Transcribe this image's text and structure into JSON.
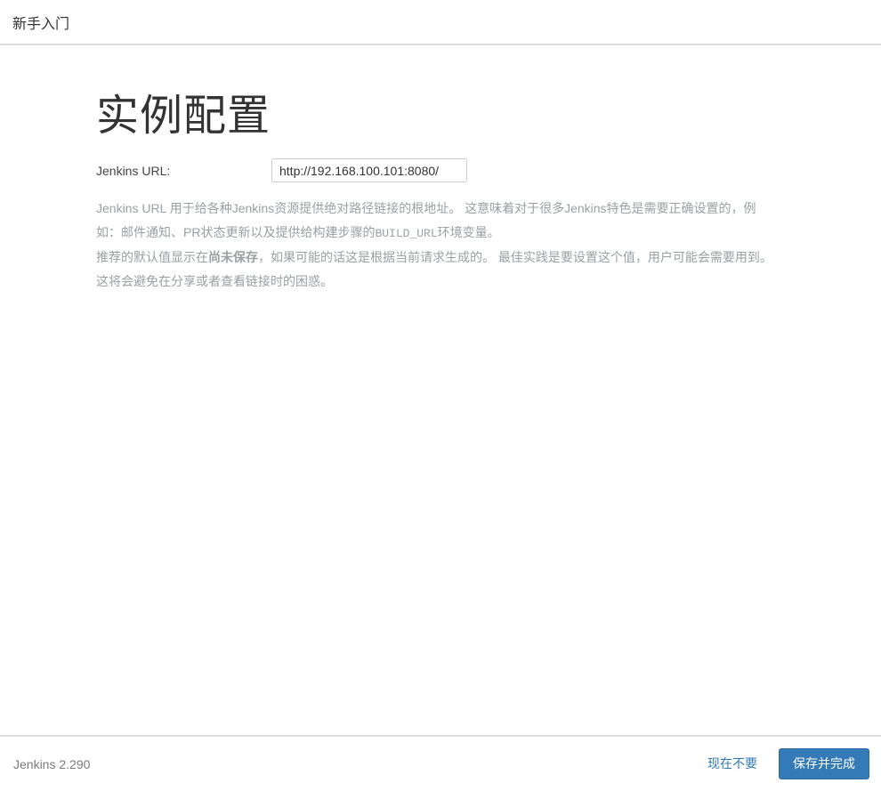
{
  "header": {
    "title": "新手入门"
  },
  "main": {
    "title": "实例配置",
    "form": {
      "label": "Jenkins URL:",
      "input_value": "http://192.168.100.101:8080/"
    },
    "description": {
      "p1_seg1": "Jenkins URL 用于给各种Jenkins资源提供绝对路径链接的根地址。 这意味着对于很多Jenkins特色是需要正确设置的，例如：邮件通知、PR状态更新以及提供给构建步骤的",
      "p1_mono": "BUILD_URL",
      "p1_seg2": "环境变量。",
      "p2_seg1": "推荐的默认值显示在",
      "p2_bold": "尚未保存",
      "p2_seg2": "，如果可能的话这是根据当前请求生成的。 最佳实践是要设置这个值，用户可能会需要用到。这将会避免在分享或者查看链接时的困惑。"
    }
  },
  "footer": {
    "version": "Jenkins 2.290",
    "not_now_label": "现在不要",
    "save_label": "保存并完成"
  },
  "colors": {
    "accent_blue": "#337ab7",
    "accent_blue_border": "#2e6da4",
    "description_text": "#9aa0a5",
    "divider": "#dddddd",
    "button_text": "#ffffff"
  }
}
